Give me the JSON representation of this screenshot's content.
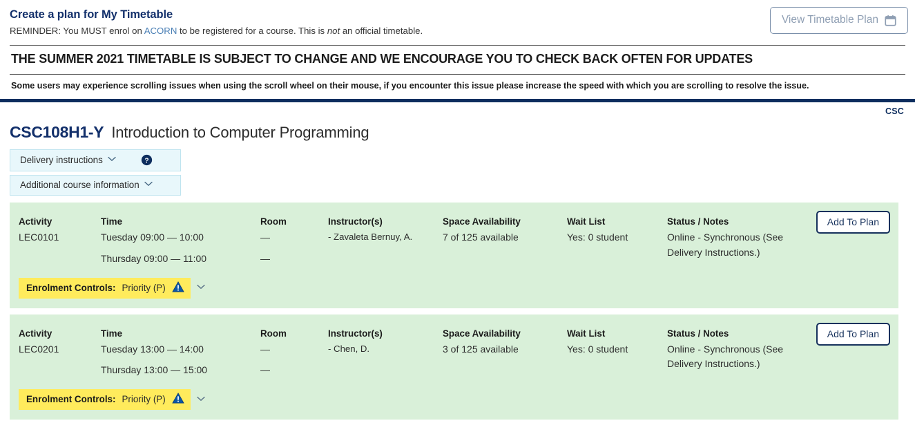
{
  "header": {
    "title": "Create a plan for My Timetable",
    "reminder_prefix": "REMINDER: You MUST enrol on ",
    "reminder_link": "ACORN",
    "reminder_mid": " to be registered for a course. This is ",
    "reminder_em": "not",
    "reminder_suffix": " an official timetable.",
    "view_plan_label": "View Timetable Plan",
    "view_plan_icon": "calendar-icon"
  },
  "notices": {
    "major": "THE SUMMER 2021 TIMETABLE IS SUBJECT TO CHANGE AND WE ENCOURAGE YOU TO CHECK BACK OFTEN FOR UPDATES",
    "minor": "Some users may experience scrolling issues when using the scroll wheel on their mouse, if you encounter this issue please increase the speed with which you are scrolling to resolve the issue."
  },
  "course": {
    "dept_tag": "CSC",
    "code": "CSC108H1-Y",
    "name": "Introduction to Computer Programming",
    "accordions": [
      {
        "label": "Delivery instructions",
        "chevron": "chevron-down-icon",
        "help": "help-circle-icon"
      },
      {
        "label": "Additional course information",
        "chevron": "chevron-down-icon"
      }
    ]
  },
  "columns": {
    "activity": "Activity",
    "time": "Time",
    "room": "Room",
    "instructor": "Instructor(s)",
    "space": "Space Availability",
    "wait": "Wait List",
    "status": "Status / Notes"
  },
  "add_to_plan_label": "Add To Plan",
  "enrolment": {
    "label": "Enrolment Controls:",
    "value": "Priority (P)",
    "warning_icon": "warning-triangle-icon",
    "chevron": "chevron-down-icon"
  },
  "sections": [
    {
      "activity": "LEC0101",
      "times": [
        "Tuesday 09:00 — 10:00",
        "Thursday 09:00 — 11:00"
      ],
      "rooms": [
        "—",
        "—"
      ],
      "instructors": [
        "- Zavaleta Bernuy, A."
      ],
      "space": "7 of 125 available",
      "wait": "Yes: 0 student",
      "status": [
        "Online - Synchronous (See",
        "Delivery Instructions.)"
      ]
    },
    {
      "activity": "LEC0201",
      "times": [
        "Tuesday 13:00 — 14:00",
        "Thursday 13:00 — 15:00"
      ],
      "rooms": [
        "—",
        "—"
      ],
      "instructors": [
        "- Chen, D."
      ],
      "space": "3 of 125 available",
      "wait": "Yes: 0 student",
      "status": [
        "Online - Synchronous (See",
        "Delivery Instructions.)"
      ]
    }
  ],
  "colors": {
    "brand_navy": "#0d2d5e",
    "panel_green": "#d9f0d9",
    "badge_yellow": "#ffeb5c",
    "accordion_blue": "#e8f7fb",
    "link_blue": "#4a7fb5"
  }
}
